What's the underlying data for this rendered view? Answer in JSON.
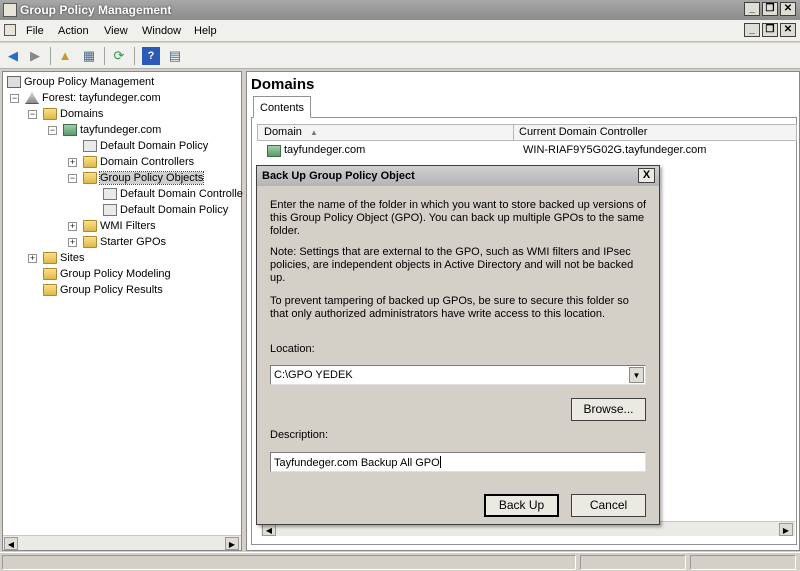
{
  "window": {
    "title": "Group Policy Management"
  },
  "menu": {
    "file": "File",
    "action": "Action",
    "view": "View",
    "window": "Window",
    "help": "Help"
  },
  "tree": {
    "root": "Group Policy Management",
    "forest": "Forest: tayfundeger.com",
    "domains": "Domains",
    "domain": "tayfundeger.com",
    "default_domain_policy": "Default Domain Policy",
    "domain_controllers": "Domain Controllers",
    "gpo_folder": "Group Policy Objects",
    "gpo_child_1": "Default Domain Controlle",
    "gpo_child_2": "Default Domain Policy",
    "wmi_filters": "WMI Filters",
    "starter_gpos": "Starter GPOs",
    "sites": "Sites",
    "modeling": "Group Policy Modeling",
    "results": "Group Policy Results"
  },
  "right_pane": {
    "title": "Domains",
    "tab": "Contents",
    "columns": {
      "domain": "Domain",
      "controller": "Current Domain Controller"
    },
    "rows": [
      {
        "domain": "tayfundeger.com",
        "controller": "WIN-RIAF9Y5G02G.tayfundeger.com"
      }
    ]
  },
  "dialog": {
    "title": "Back Up Group Policy Object",
    "close": "X",
    "intro": "Enter the name of the folder in which you want to store backed up versions of this Group Policy Object (GPO). You can back up multiple GPOs to the same folder.",
    "note": "Note: Settings that are external to the GPO, such as WMI filters and IPsec policies, are independent objects in Active Directory and will not be backed up.",
    "warning": "To prevent tampering of backed up GPOs, be sure to secure this folder so that only authorized administrators have write access to this location.",
    "location_label": "Location:",
    "location_value": "C:\\GPO YEDEK",
    "browse": "Browse...",
    "description_label": "Description:",
    "description_value": "Tayfundeger.com Backup All GPO",
    "backup_button": "Back Up",
    "cancel_button": "Cancel"
  }
}
